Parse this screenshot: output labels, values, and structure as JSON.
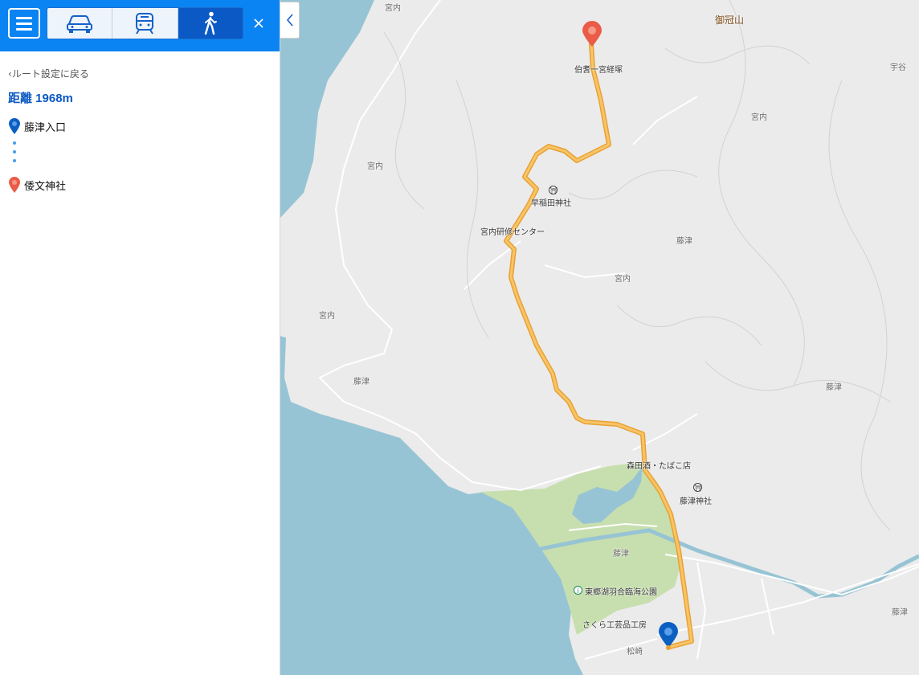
{
  "toolbar": {
    "menu_icon": "hamburger-icon",
    "modes": [
      {
        "icon": "car-icon",
        "active": false
      },
      {
        "icon": "train-icon",
        "active": false
      },
      {
        "icon": "walk-icon",
        "active": true
      }
    ],
    "close_icon": "close-icon"
  },
  "route": {
    "back_label": "ルート設定に戻る",
    "distance_label": "距離 1968m",
    "origin": "藤津入口",
    "destination": "倭文神社"
  },
  "map": {
    "labels": {
      "miyauchi_top": "宮内",
      "mikanmuriyama": "御冠山",
      "houki": "伯耆一宮経塚",
      "uya": "宇谷",
      "miyauchi_right": "宮内",
      "miyauchi_left": "宮内",
      "hayakita_shrine": "早稲田神社",
      "kenshu_center": "宮内研修センター",
      "fujitsu_mid": "藤津",
      "miyauchi_mid": "宮内",
      "miyauchi_far_left": "宮内",
      "fujitsu_left": "藤津",
      "fujitsu_right": "藤津",
      "morita_shop": "森田酒・たばこ店",
      "fujitsu_shrine": "藤津神社",
      "fujitsu_park": "藤津",
      "park_name": "東郷湖羽合臨海公園",
      "sakura": "さくら工芸品工房",
      "matsuzaki": "松崎",
      "fujitsu_bottom_right": "藤津"
    },
    "colors": {
      "water": "#97c4d4",
      "land": "#ebebeb",
      "park": "#c7dfae",
      "route": "#f5b347",
      "origin_pin": "#0b5fc2",
      "destination_pin": "#ea5b48"
    }
  }
}
